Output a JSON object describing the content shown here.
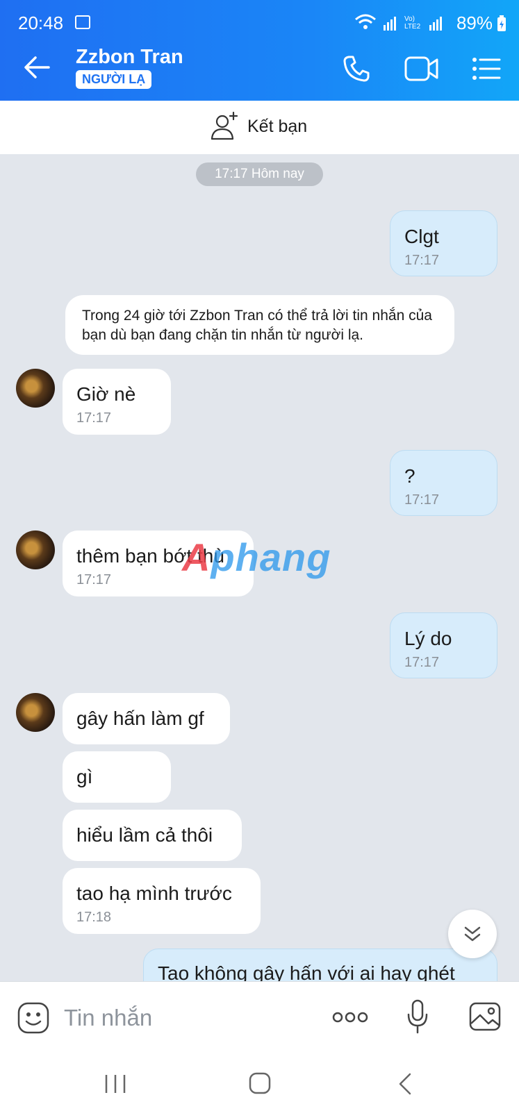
{
  "status": {
    "time": "20:48",
    "battery": "89%",
    "network": "Vo) LTE2"
  },
  "header": {
    "title": "Zzbon Tran",
    "badge": "NGƯỜI LẠ"
  },
  "friend_bar": {
    "label": "Kết bạn"
  },
  "date_pill": "17:17 Hôm nay",
  "notice": "Trong 24 giờ tới Zzbon Tran có thể trả lời tin nhắn của bạn dù bạn đang chặn tin nhắn từ người lạ.",
  "messages": [
    {
      "from": "me",
      "text": "Clgt",
      "time": "17:17"
    },
    {
      "from": "them",
      "text": "Giờ nè",
      "time": "17:17"
    },
    {
      "from": "me",
      "text": "?",
      "time": "17:17"
    },
    {
      "from": "them",
      "text": "thêm bạn bớt thù",
      "time": "17:17"
    },
    {
      "from": "me",
      "text": "Lý do",
      "time": "17:17"
    },
    {
      "from": "them",
      "text": "gây hấn làm gf",
      "time": ""
    },
    {
      "from": "them",
      "text": "gì",
      "time": ""
    },
    {
      "from": "them",
      "text": "hiểu lầm cả thôi",
      "time": ""
    },
    {
      "from": "them",
      "text": "tao hạ mình trước",
      "time": "17:18"
    },
    {
      "from": "me",
      "text": "Tao không gây hấn với ai hay ghét",
      "time": ""
    }
  ],
  "watermark": "Aphang",
  "composer": {
    "placeholder": "Tin nhắn"
  },
  "icons": {
    "back": "arrow-left-icon",
    "call": "phone-icon",
    "video": "video-camera-icon",
    "menu": "list-menu-icon",
    "add_friend": "add-user-icon",
    "emoji": "emoji-icon",
    "more": "more-dots-icon",
    "mic": "microphone-icon",
    "image": "image-icon",
    "scroll": "double-chevron-down-icon"
  },
  "colors": {
    "header_start": "#1f6ff2",
    "header_end": "#12a6f8",
    "my_bubble": "#d7ecfb",
    "their_bubble": "#ffffff",
    "chat_bg": "#e2e6ec"
  }
}
